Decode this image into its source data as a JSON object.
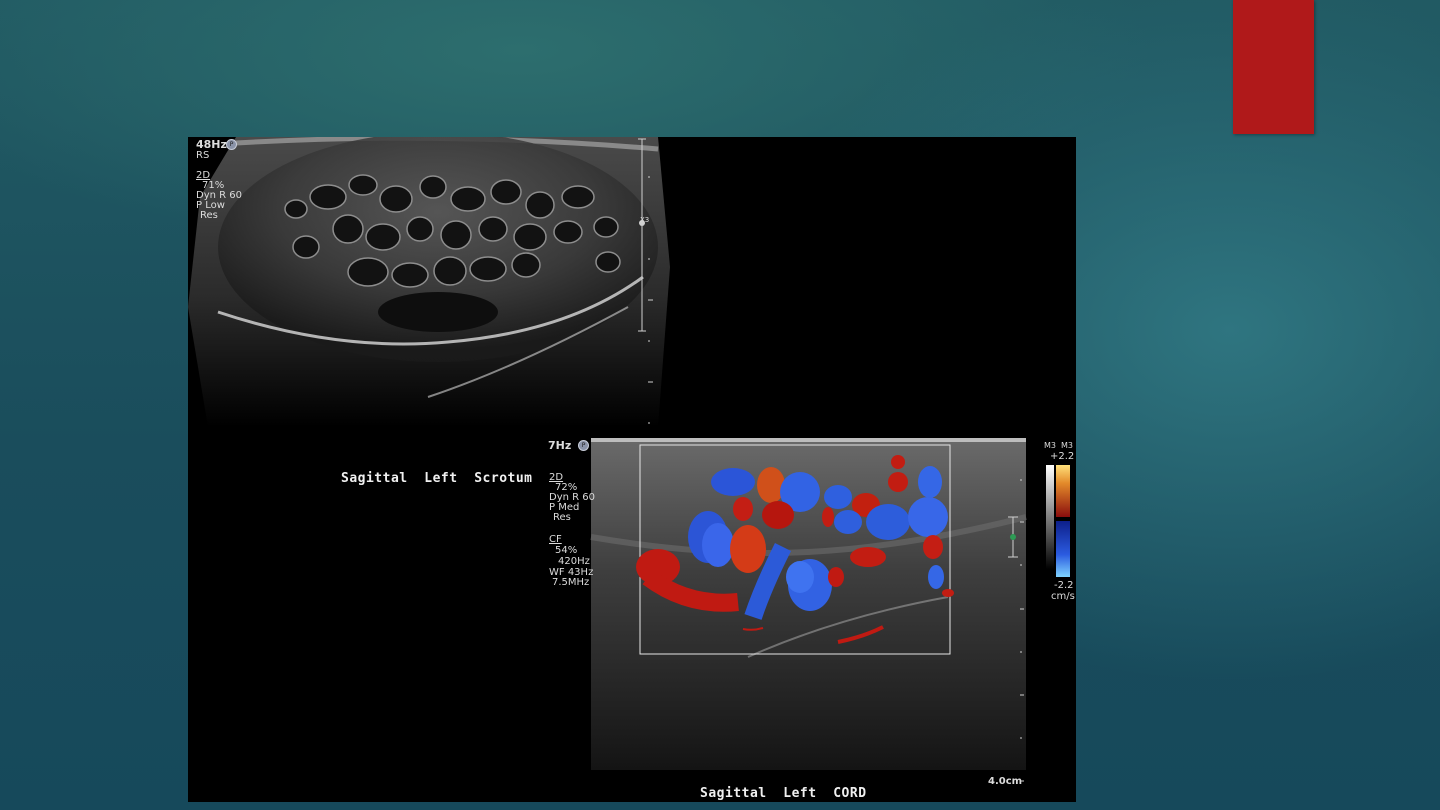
{
  "slide": {
    "accent_color": "#b0191a"
  },
  "top_image": {
    "frame_rate": "48Hz",
    "mode": "RS",
    "params": [
      "2D",
      "71%",
      "Dyn R 60",
      "P Low",
      "Res"
    ],
    "probe_badge": "P",
    "caption": "Sagittal  Left  Scrotum",
    "scale_marker": "X3"
  },
  "bottom_image": {
    "frame_rate": "7Hz",
    "probe_badge": "P",
    "params_2d": [
      "2D",
      "72%",
      "Dyn R 60",
      "P Med",
      "Res"
    ],
    "params_cf": [
      "CF",
      "54%",
      "420Hz",
      "WF 43Hz",
      "7.5MHz"
    ],
    "caption": "Sagittal  Left  CORD",
    "depth": "4.0cm"
  },
  "color_scale": {
    "header_left": "M3",
    "header_right": "M3",
    "max": "+2.2",
    "min": "-2.2",
    "unit": "cm/s"
  }
}
